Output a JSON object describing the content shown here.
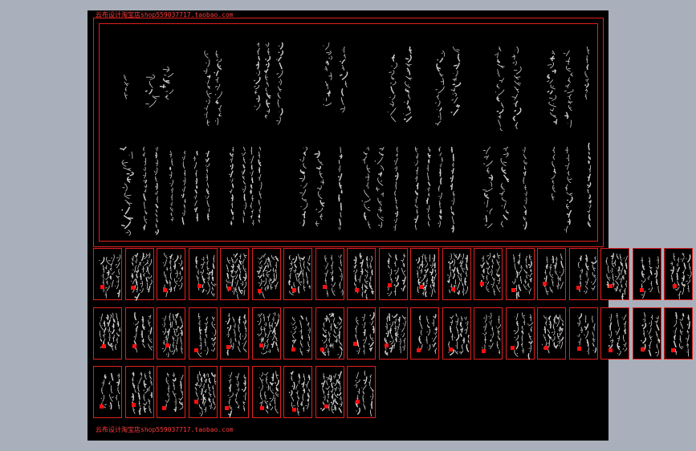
{
  "watermark": {
    "top": "云布设计淘宝店shop559037717.taobao.com",
    "bottom": "云布设计淘宝店shop559037717.taobao.com"
  },
  "colors": {
    "background": "#a9b0bb",
    "canvas": "#000000",
    "frame": "#e0201f",
    "strokes": "#d0d0d0",
    "seal": "#ff1010"
  },
  "tiles": {
    "rows": [
      20,
      20,
      9
    ]
  }
}
